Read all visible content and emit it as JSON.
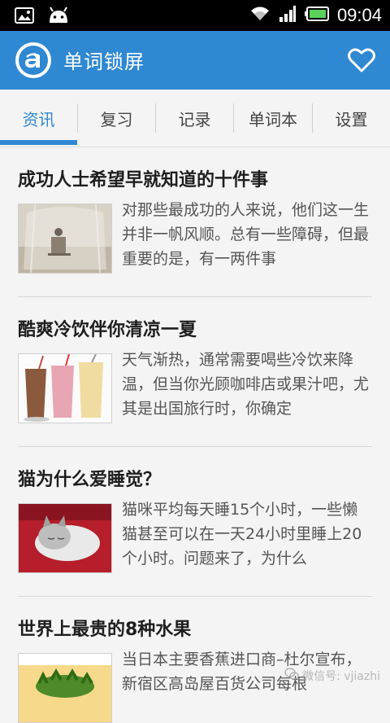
{
  "status_bar": {
    "time": "09:04",
    "icons": [
      "image-icon",
      "android-icon",
      "wifi-icon",
      "signal-icon",
      "battery-icon"
    ]
  },
  "app_bar": {
    "title": "单词锁屏",
    "accent_color": "#2f88d2"
  },
  "tabs": [
    {
      "label": "资讯",
      "active": true
    },
    {
      "label": "复习",
      "active": false
    },
    {
      "label": "记录",
      "active": false
    },
    {
      "label": "单词本",
      "active": false
    },
    {
      "label": "设置",
      "active": false
    }
  ],
  "articles": [
    {
      "title": "成功人士希望早就知道的十件事",
      "snippet": "对那些最成功的人来说，他们这一生并非一帆风顺。总有一些障碍，但最重要的是，有一两件事",
      "thumb": "person-reading-under-net"
    },
    {
      "title": "酷爽冷饮伴你清凉一夏",
      "snippet": "天气渐热，通常需要喝些冷饮来降温，但当你光顾咖啡店或果汁吧，尤其是出国旅行时，你确定",
      "thumb": "milkshakes"
    },
    {
      "title": "猫为什么爱睡觉？",
      "snippet": "猫咪平均每天睡15个小时，一些懒猫甚至可以在一天24小时里睡上20个小时。问题来了，为什么",
      "thumb": "sleeping-cat"
    },
    {
      "title": "世界上最贵的8种水果",
      "snippet": "当日本主要香蕉进口商–杜尔宣布，新宿区高岛屋百货公司每根",
      "thumb": "fruit"
    }
  ],
  "watermark": "微信号: vjiazhi"
}
